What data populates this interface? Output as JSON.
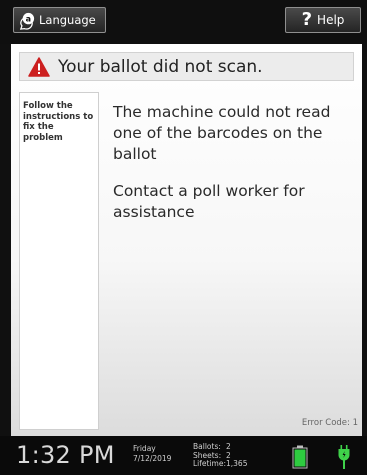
{
  "header": {
    "language_label": "Language",
    "language_icon": "language-icon",
    "help_label": "Help",
    "help_icon": "question-mark-icon"
  },
  "banner": {
    "icon": "warning-icon",
    "icon_color": "#cc1f1f",
    "text": "Your ballot did not scan."
  },
  "side_panel": {
    "text": "Follow the instructions to fix the problem"
  },
  "messages": [
    "The machine could not read one of the barcodes on the ballot",
    "Contact a poll worker for assistance"
  ],
  "error_code": "Error Code: 1",
  "status_bar": {
    "time": "1:32 PM",
    "day": "Friday",
    "date": "7/12/2019",
    "stats": [
      {
        "label": "Ballots:",
        "value": "2"
      },
      {
        "label": "Sheets:",
        "value": "2"
      },
      {
        "label": "Lifetime:",
        "value": "1,365"
      }
    ],
    "battery_icon": "battery-icon",
    "battery_level": 1.0,
    "battery_color": "#2ecc40",
    "power_icon": "power-plug-icon"
  }
}
